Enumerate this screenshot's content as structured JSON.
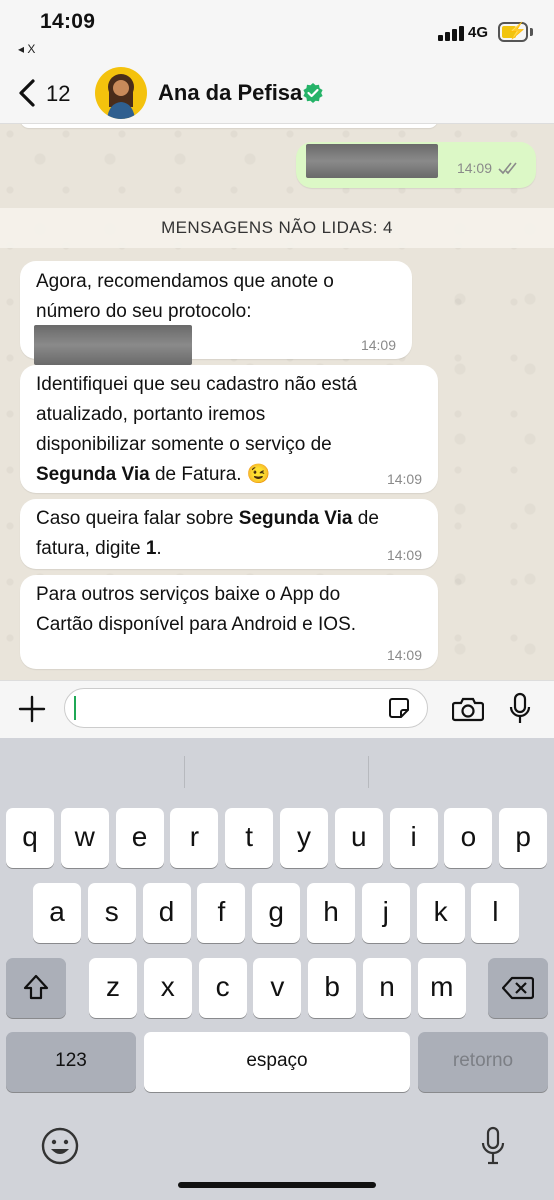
{
  "status": {
    "time": "14:09",
    "back_app": "◂ X",
    "network": "4G",
    "icons": [
      "signal-icon",
      "battery-charging-icon"
    ]
  },
  "header": {
    "back_count": "12",
    "name": "Ana da Pefisa",
    "icons": [
      "back-chevron-icon",
      "verified-badge-icon"
    ]
  },
  "chat": {
    "outgoing": {
      "time": "14:09",
      "status": "read"
    },
    "unread_banner": "MENSAGENS NÃO LIDAS: 4",
    "messages": [
      {
        "l1": "Agora, recomendamos que anote o",
        "l2": "número do seu protocolo:",
        "time": "14:09"
      },
      {
        "l1": "Identifiquei que seu cadastro não está",
        "l2": "atualizado, portanto iremos",
        "l3": "disponibilizar somente o serviço de",
        "l4_bold": "Segunda Via",
        "l4_rest": " de Fatura. 😉",
        "time": "14:09"
      },
      {
        "l1_pre": "Caso queira falar sobre ",
        "l1_bold": "Segunda Via",
        "l1_post": " de",
        "l2_pre": "fatura, digite ",
        "l2_bold": "1",
        "l2_post": ".",
        "time": "14:09"
      },
      {
        "l1": "Para outros serviços baixe o App do",
        "l2": "Cartão disponível para Android e IOS.",
        "time": "14:09"
      }
    ]
  },
  "composer": {
    "value": "",
    "icons": [
      "plus-icon",
      "sticker-icon",
      "camera-icon",
      "microphone-icon"
    ]
  },
  "keyboard": {
    "row1": [
      "q",
      "w",
      "e",
      "r",
      "t",
      "y",
      "u",
      "i",
      "o",
      "p"
    ],
    "row2": [
      "a",
      "s",
      "d",
      "f",
      "g",
      "h",
      "j",
      "k",
      "l"
    ],
    "row3": [
      "z",
      "x",
      "c",
      "v",
      "b",
      "n",
      "m"
    ],
    "numbers": "123",
    "space": "espaço",
    "return": "retorno",
    "icons": [
      "shift-icon",
      "backspace-icon",
      "emoji-icon",
      "dictation-mic-icon"
    ]
  },
  "colors": {
    "outgoing_bubble": "#dcf8c6",
    "incoming_bubble": "#ffffff",
    "verified": "#25b368",
    "caret": "#1fa855"
  }
}
